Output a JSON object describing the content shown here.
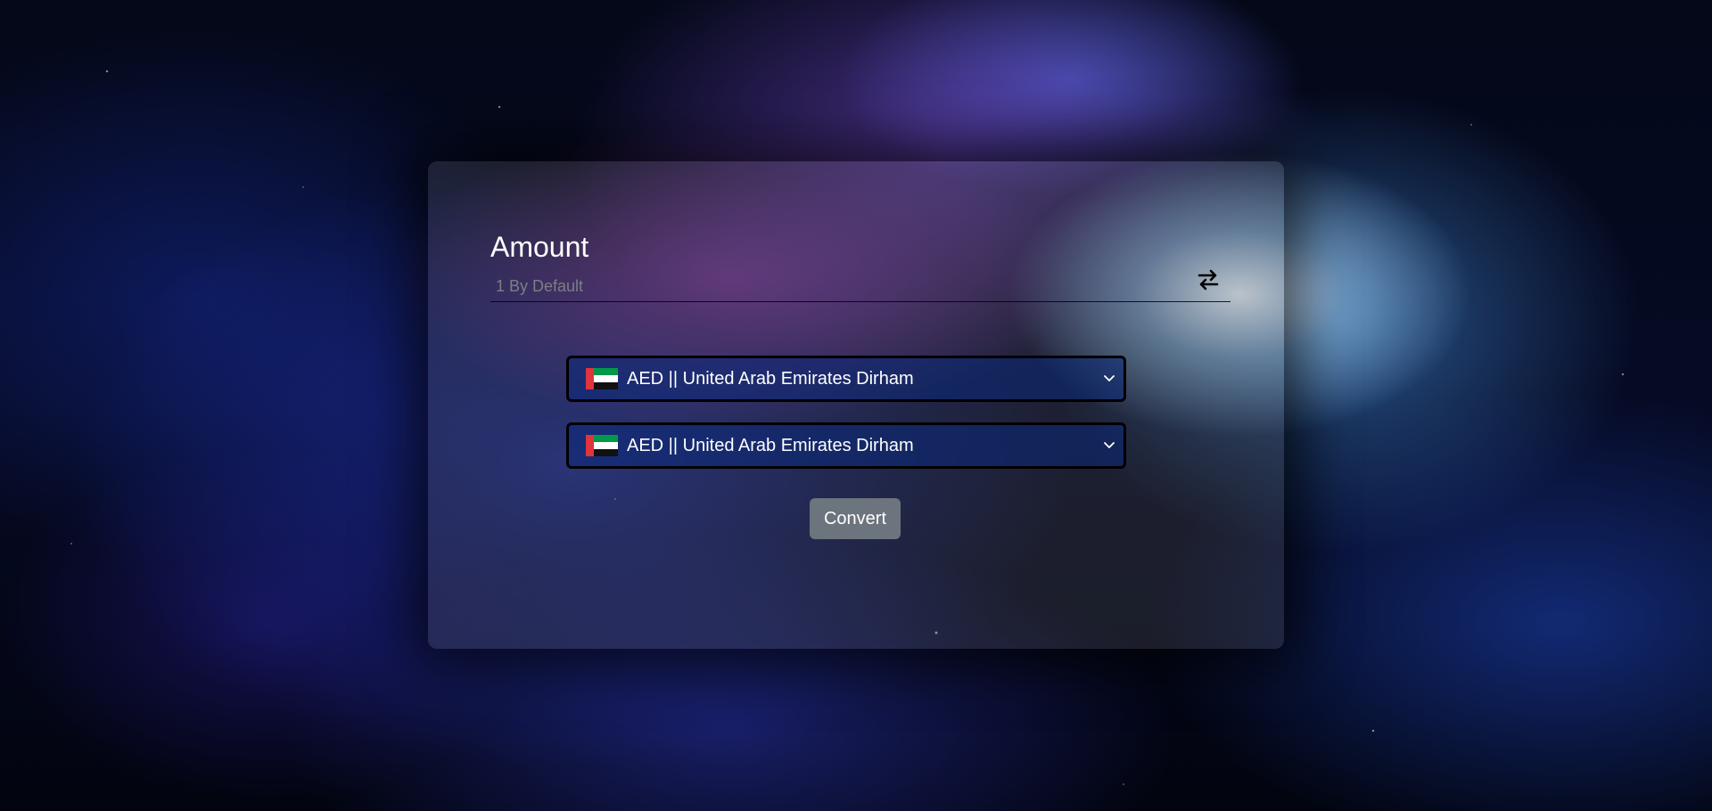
{
  "amount": {
    "label": "Amount",
    "placeholder": "1 By Default"
  },
  "swap": {
    "icon": "swap-arrows-icon"
  },
  "from_currency": {
    "selected": "AED || United Arab Emirates Dirham",
    "flag_icon": "uae-flag-icon"
  },
  "to_currency": {
    "selected": "AED || United Arab Emirates Dirham",
    "flag_icon": "uae-flag-icon"
  },
  "convert": {
    "label": "Convert"
  },
  "colors": {
    "button": "#6c757d",
    "text": "#ffffff"
  }
}
